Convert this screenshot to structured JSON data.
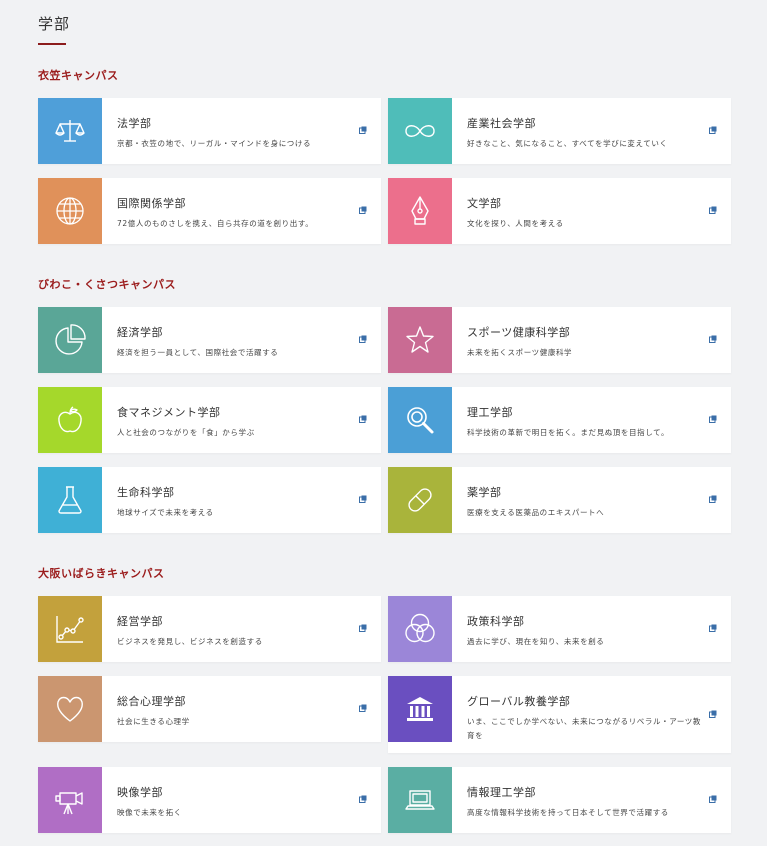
{
  "page_title": "学部",
  "campuses": [
    {
      "name": "衣笠キャンパス",
      "faculties": [
        {
          "name": "法学部",
          "desc": "京都・衣笠の地で、リーガル・マインドを身につける",
          "color": "#4f9fd9",
          "icon": "scales-icon"
        },
        {
          "name": "産業社会学部",
          "desc": "好きなこと、気になること、すべてを学びに変えていく",
          "color": "#4fbdb9",
          "icon": "infinity-icon"
        },
        {
          "name": "国際関係学部",
          "desc": "72億人のものさしを携え、自ら共存の道を創り出す。",
          "color": "#e0915a",
          "icon": "globe-icon"
        },
        {
          "name": "文学部",
          "desc": "文化を探り、人間を考える",
          "color": "#ec6f8c",
          "icon": "pen-nib-icon"
        }
      ]
    },
    {
      "name": "びわこ・くさつキャンパス",
      "faculties": [
        {
          "name": "経済学部",
          "desc": "経済を担う一員として、国際社会で活躍する",
          "color": "#5aa697",
          "icon": "pie-chart-icon"
        },
        {
          "name": "スポーツ健康科学部",
          "desc": "未来を拓くスポーツ健康科学",
          "color": "#c96b93",
          "icon": "star-icon"
        },
        {
          "name": "食マネジメント学部",
          "desc": "人と社会のつながりを「食」から学ぶ",
          "color": "#a5d82b",
          "icon": "apple-icon"
        },
        {
          "name": "理工学部",
          "desc": "科学技術の革新で明日を拓く。まだ見ぬ頂を目指して。",
          "color": "#4b9fd6",
          "icon": "magnifier-icon"
        },
        {
          "name": "生命科学部",
          "desc": "地球サイズで未来を考える",
          "color": "#3fb0d6",
          "icon": "flask-icon"
        },
        {
          "name": "薬学部",
          "desc": "医療を支える医薬品のエキスパートへ",
          "color": "#a9b43b",
          "icon": "capsule-icon"
        }
      ]
    },
    {
      "name": "大阪いばらきキャンパス",
      "faculties": [
        {
          "name": "経営学部",
          "desc": "ビジネスを発見し、ビジネスを創造する",
          "color": "#c3a13c",
          "icon": "line-graph-icon"
        },
        {
          "name": "政策科学部",
          "desc": "過去に学び、現在を知り、未来を創る",
          "color": "#9b86d8",
          "icon": "venn-icon"
        },
        {
          "name": "総合心理学部",
          "desc": "社会に生きる心理学",
          "color": "#cb9670",
          "icon": "heart-icon"
        },
        {
          "name": "グローバル教養学部",
          "desc": "いま、ここでしか学べない、未来につながるリベラル・アーツ教育を",
          "color": "#6a4fc0",
          "icon": "institution-icon"
        },
        {
          "name": "映像学部",
          "desc": "映像で未来を拓く",
          "color": "#b06ec5",
          "icon": "movie-camera-icon"
        },
        {
          "name": "情報理工学部",
          "desc": "高度な情報科学技術を持って日本そして世界で活躍する",
          "color": "#5aaea3",
          "icon": "laptop-icon"
        }
      ]
    }
  ]
}
